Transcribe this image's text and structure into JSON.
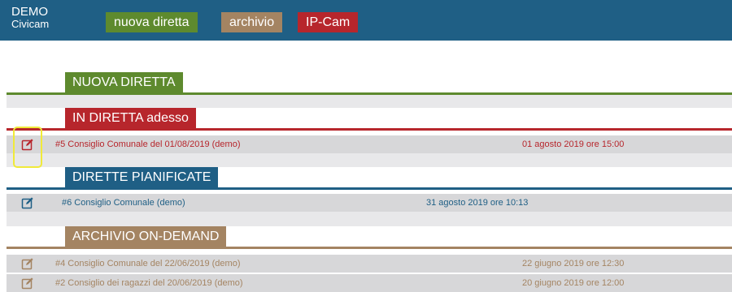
{
  "brand": {
    "line1": "DEMO",
    "line2": "Civicam"
  },
  "nav": {
    "nuova": "nuova diretta",
    "archivio": "archivio",
    "ipcam": "IP-Cam"
  },
  "sections": {
    "nuova": {
      "title": "NUOVA DIRETTA"
    },
    "live": {
      "title": "IN DIRETTA adesso",
      "rows": [
        {
          "title": "#5 Consiglio Comunale del 01/08/2019 (demo)",
          "date": "01 agosto 2019 ore 15:00"
        }
      ]
    },
    "planned": {
      "title": "DIRETTE PIANIFICATE",
      "rows": [
        {
          "title": "#6 Consiglio Comunale (demo)",
          "date": "31 agosto 2019 ore 10:13"
        }
      ]
    },
    "archive": {
      "title": "ARCHIVIO ON-DEMAND",
      "rows": [
        {
          "title": "#4 Consiglio Comunale del 22/06/2019 (demo)",
          "date": "22 giugno 2019 ore 12:30"
        },
        {
          "title": "#2 Consiglio dei ragazzi del 20/06/2019 (demo)",
          "date": "20 giugno 2019 ore 12:00"
        }
      ]
    }
  },
  "icons": {
    "edit": "edit-pencil-icon"
  },
  "colors": {
    "topbar": "#1f5f85",
    "green": "#5e8a2e",
    "brown": "#a48462",
    "red": "#b7262c",
    "blue": "#1f5f85"
  }
}
